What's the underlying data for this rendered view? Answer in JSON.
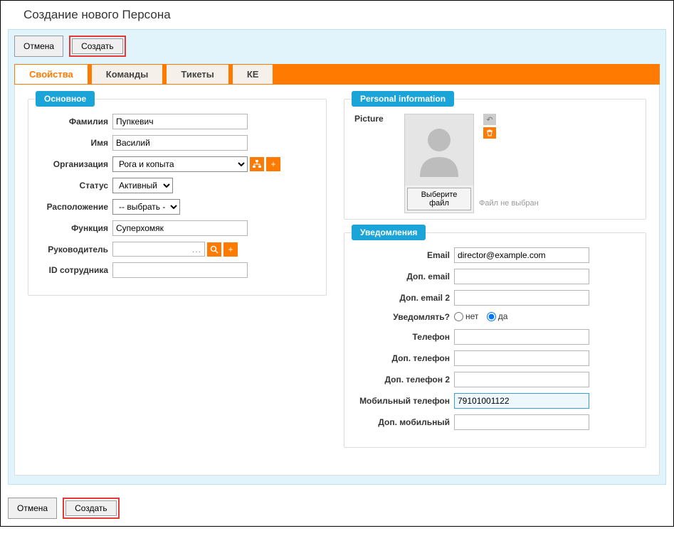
{
  "header": {
    "title": "Создание нового Персона"
  },
  "buttons": {
    "cancel": "Отмена",
    "create": "Создать"
  },
  "tabs": {
    "props": "Свойства",
    "teams": "Команды",
    "tickets": "Тикеты",
    "ci": "КЕ"
  },
  "main": {
    "legend": "Основное",
    "labels": {
      "lastname": "Фамилия",
      "firstname": "Имя",
      "org": "Организация",
      "status": "Статус",
      "location": "Расположение",
      "function": "Функция",
      "supervisor": "Руководитель",
      "employee_id": "ID сотрудника"
    },
    "values": {
      "lastname": "Пупкевич",
      "firstname": "Василий",
      "org": "Рога и копыта",
      "status": "Активный",
      "location": "-- выбрать --",
      "function": "Суперхомяк",
      "supervisor_dots": "...",
      "employee_id": ""
    }
  },
  "picture": {
    "legend": "Personal information",
    "label": "Picture",
    "choose": "Выберите файл",
    "nofile": "Файл не выбран"
  },
  "notify": {
    "legend": "Уведомления",
    "labels": {
      "email": "Email",
      "email2": "Доп. email",
      "email3": "Доп. email 2",
      "notify_q": "Уведомлять?",
      "no": "нет",
      "yes": "да",
      "phone": "Телефон",
      "phone2": "Доп. телефон",
      "phone3": "Доп. телефон 2",
      "mobile": "Мобильный телефон",
      "mobile2": "Доп. мобильный"
    },
    "values": {
      "email": "director@example.com",
      "email2": "",
      "email3": "",
      "phone": "",
      "phone2": "",
      "phone3": "",
      "mobile": "79101001122",
      "mobile2": ""
    }
  }
}
